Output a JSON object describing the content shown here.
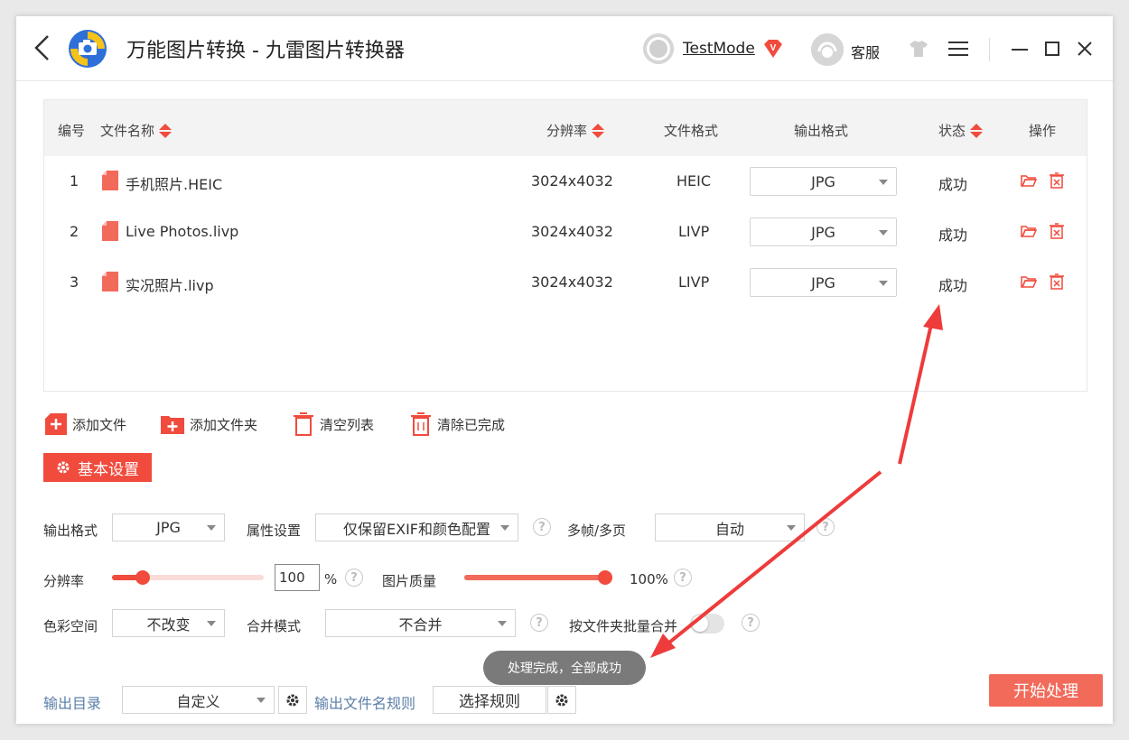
{
  "app": {
    "title": "万能图片转换 - 九雷图片转换器",
    "user_name": "TestMode",
    "vip_badge": "V",
    "customer_service": "客服"
  },
  "table": {
    "headers": {
      "index": "编号",
      "filename": "文件名称",
      "resolution": "分辨率",
      "format": "文件格式",
      "output_format": "输出格式",
      "status": "状态",
      "actions": "操作"
    },
    "rows": [
      {
        "index": "1",
        "filename": "手机照片.HEIC",
        "resolution": "3024x4032",
        "format": "HEIC",
        "output": "JPG",
        "status": "成功"
      },
      {
        "index": "2",
        "filename": "Live Photos.livp",
        "resolution": "3024x4032",
        "format": "LIVP",
        "output": "JPG",
        "status": "成功"
      },
      {
        "index": "3",
        "filename": "实况照片.livp",
        "resolution": "3024x4032",
        "format": "LIVP",
        "output": "JPG",
        "status": "成功"
      }
    ]
  },
  "toolbar": {
    "add_file": "添加文件",
    "add_folder": "添加文件夹",
    "clear_list": "清空列表",
    "clear_done": "清除已完成"
  },
  "settings": {
    "tab_label": "基本设置",
    "output_format_label": "输出格式",
    "output_format_value": "JPG",
    "attr_label": "属性设置",
    "attr_value": "仅保留EXIF和颜色配置",
    "multiframe_label": "多帧/多页",
    "multiframe_value": "自动",
    "resolution_label": "分辨率",
    "resolution_value": "100",
    "resolution_unit": "%",
    "resolution_fraction": 0.2,
    "quality_label": "图片质量",
    "quality_value": "100%",
    "quality_fraction": 1.0,
    "color_space_label": "色彩空间",
    "color_space_value": "不改变",
    "merge_mode_label": "合并模式",
    "merge_mode_value": "不合并",
    "batch_merge_label": "按文件夹批量合并",
    "batch_merge_on": false,
    "help_glyph": "?"
  },
  "output": {
    "dir_label": "输出目录",
    "dir_value": "自定义",
    "rule_label": "输出文件名规则",
    "rule_button": "选择规则",
    "start_button": "开始处理"
  },
  "toast": "处理完成，全部成功",
  "colors": {
    "accent": "#f04b3d",
    "start_button": "#f26a5a",
    "annotation_arrow": "#ee3b3b"
  }
}
